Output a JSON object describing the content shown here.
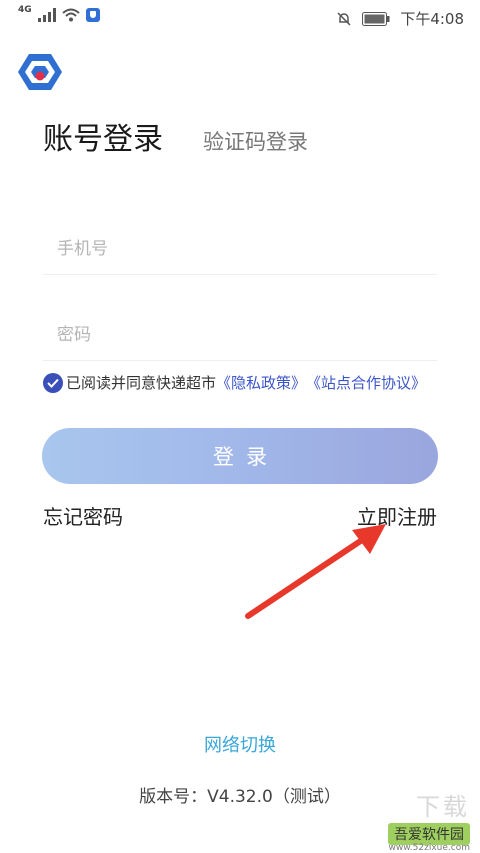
{
  "status_bar": {
    "network": "4G",
    "time": "下午4:08"
  },
  "tabs": {
    "account_login": "账号登录",
    "code_login": "验证码登录"
  },
  "form": {
    "phone_placeholder": "手机号",
    "password_placeholder": "密码"
  },
  "agreement": {
    "prefix": "已阅读并同意快递超市",
    "privacy_policy": "《隐私政策》",
    "site_agreement": "《站点合作协议》",
    "checked": true
  },
  "login_button": "登录",
  "forgot_password": "忘记密码",
  "register_now": "立即注册",
  "network_switch": "网络切换",
  "version": "版本号：V4.32.0（测试）",
  "watermark": {
    "title": "吾爱软件园",
    "url": "www.52zixue.com",
    "brand": "下载"
  },
  "colors": {
    "accent_blue": "#3b56c8",
    "network_link": "#3aa7d9",
    "arrow_red": "#e8382b"
  }
}
